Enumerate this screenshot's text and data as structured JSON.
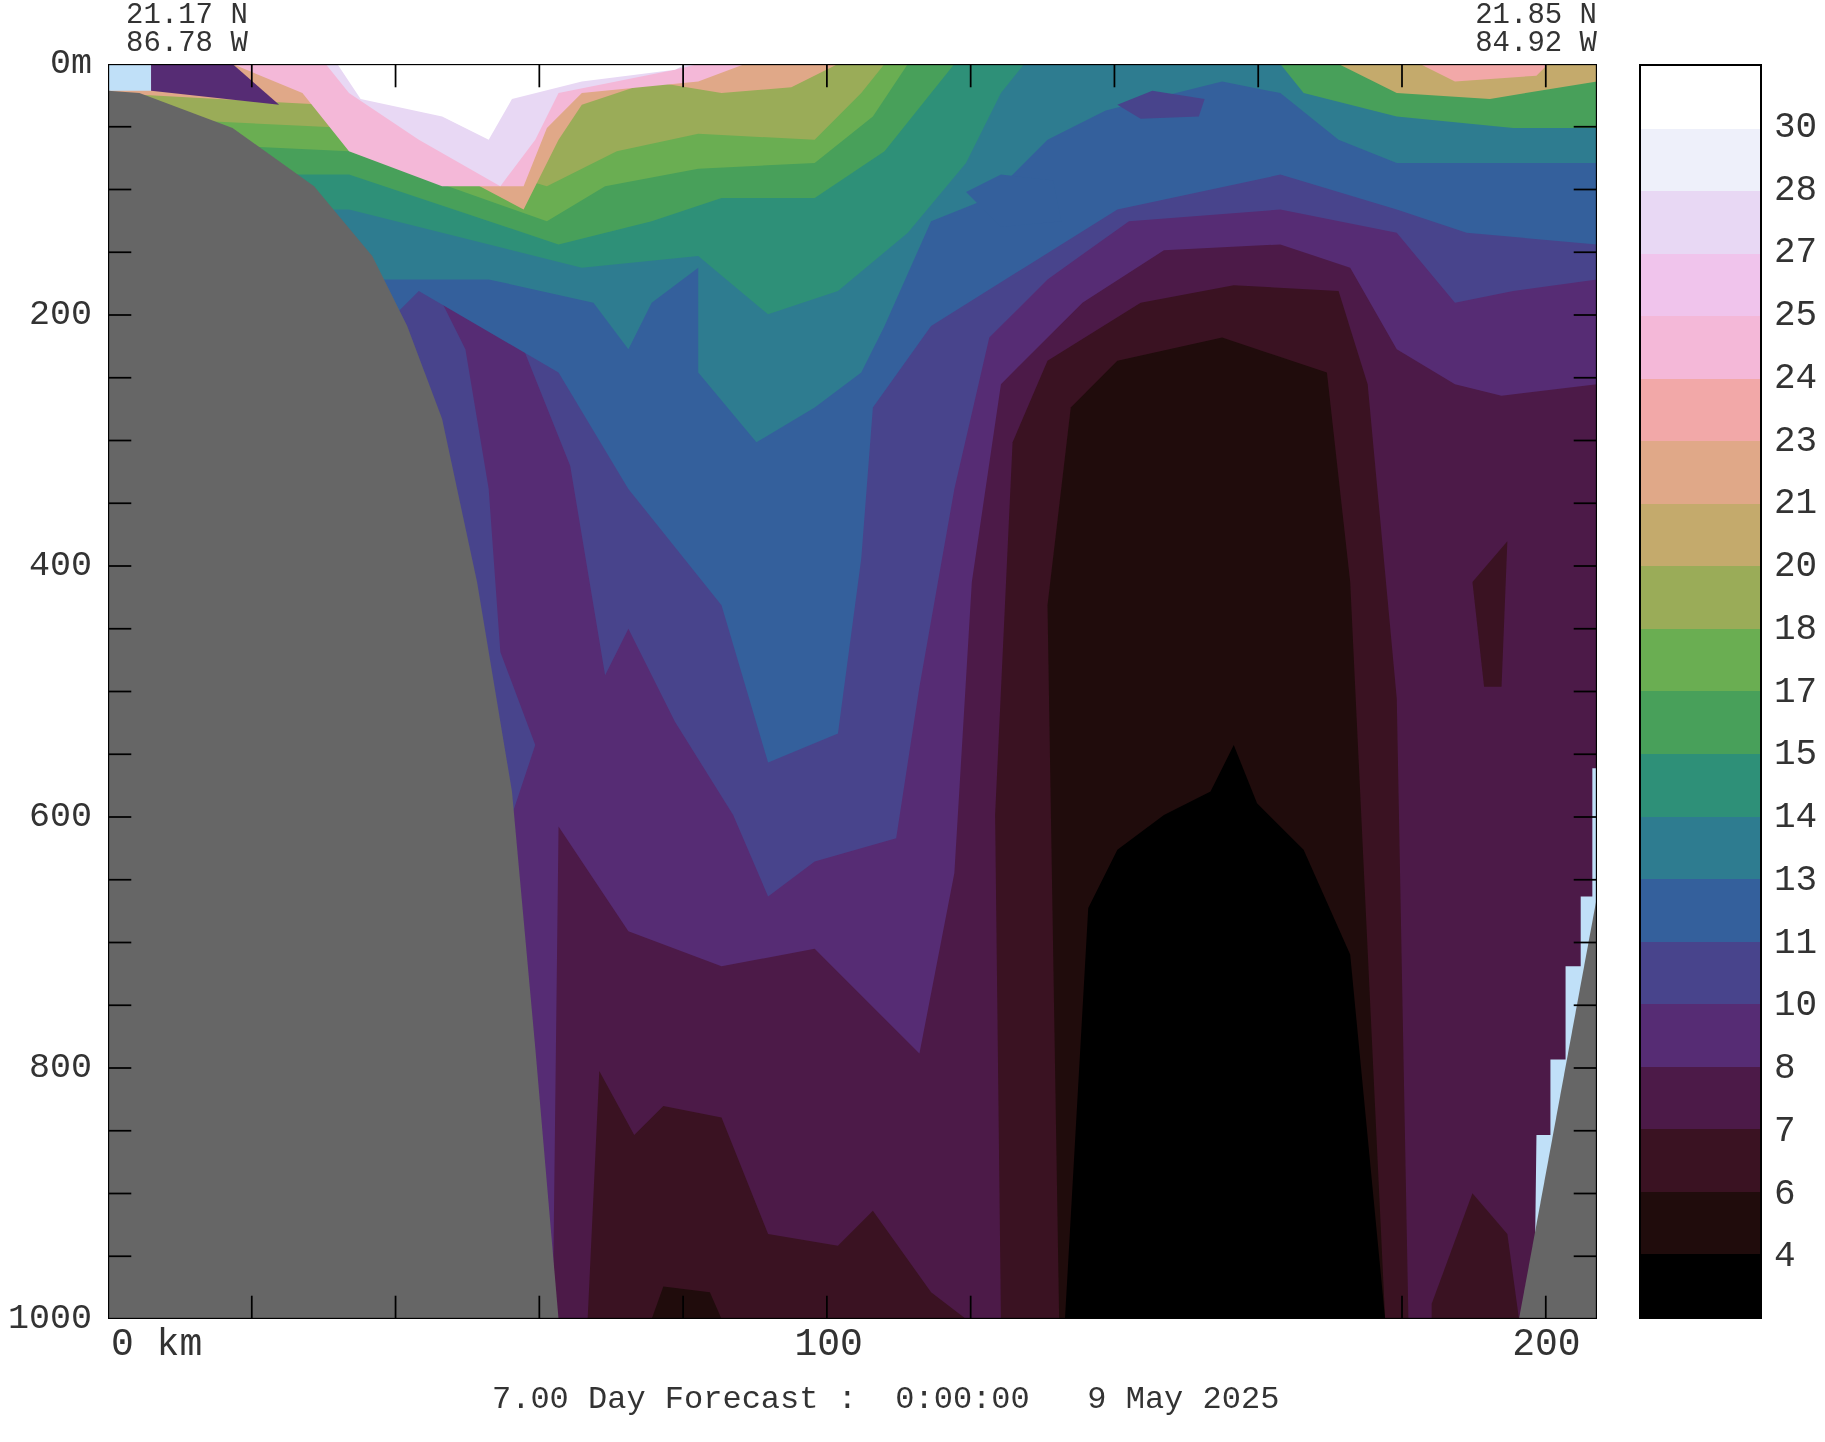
{
  "header": {
    "start": {
      "lat": "21.17 N",
      "lon": "86.78 W"
    },
    "end": {
      "lat": "21.85 N",
      "lon": "84.92 W"
    }
  },
  "y_axis": {
    "labels": [
      "0m",
      "200",
      "400",
      "600",
      "800",
      "1000"
    ]
  },
  "x_axis": {
    "labels": [
      "0 km",
      "100",
      "200"
    ]
  },
  "colorbar": {
    "bands": [
      {
        "color": "#ffffff"
      },
      {
        "color": "#eef0fa"
      },
      {
        "color": "#e8d8f4"
      },
      {
        "color": "#f0c4ec"
      },
      {
        "color": "#f4b8d8"
      },
      {
        "color": "#f2a8a8"
      },
      {
        "color": "#e0a888"
      },
      {
        "color": "#c4aa6c"
      },
      {
        "color": "#9aac58"
      },
      {
        "color": "#6aae52"
      },
      {
        "color": "#48a05a"
      },
      {
        "color": "#2e9078"
      },
      {
        "color": "#2e7c90"
      },
      {
        "color": "#34609c"
      },
      {
        "color": "#48448c"
      },
      {
        "color": "#562c74"
      },
      {
        "color": "#4c1a48"
      },
      {
        "color": "#3a1222"
      },
      {
        "color": "#200c0c"
      },
      {
        "color": "#000000"
      }
    ],
    "labels": [
      "30",
      "28",
      "27",
      "25",
      "24",
      "23",
      "21",
      "20",
      "18",
      "17",
      "15",
      "14",
      "13",
      "11",
      "10",
      "8",
      "7",
      "6",
      "4"
    ]
  },
  "caption": "7.00 Day Forecast :  0:00:00   9 May 2025"
}
